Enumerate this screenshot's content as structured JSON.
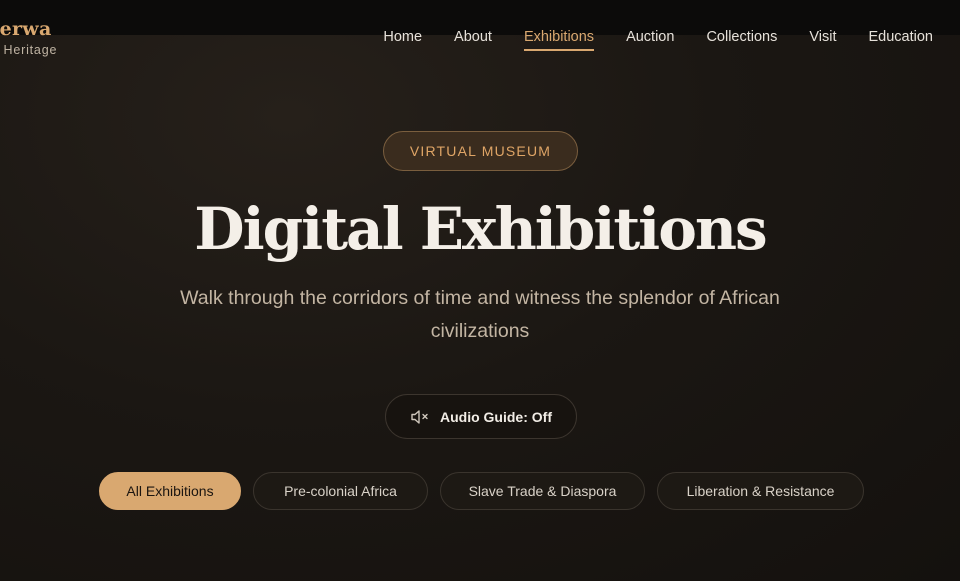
{
  "brand": {
    "name": "perwa",
    "tagline": "f Heritage"
  },
  "nav": {
    "items": [
      {
        "label": "Home"
      },
      {
        "label": "About"
      },
      {
        "label": "Exhibitions"
      },
      {
        "label": "Auction"
      },
      {
        "label": "Collections"
      },
      {
        "label": "Visit"
      },
      {
        "label": "Education"
      }
    ],
    "active": "Exhibitions"
  },
  "hero": {
    "badge": "VIRTUAL MUSEUM",
    "title": "Digital Exhibitions",
    "subtitle": "Walk through the corridors of time and witness the splendor of African civilizations"
  },
  "audio_guide": {
    "label": "Audio Guide: Off",
    "icon": "speaker-muted-icon"
  },
  "filters": {
    "items": [
      {
        "label": "All Exhibitions"
      },
      {
        "label": "Pre-colonial Africa"
      },
      {
        "label": "Slave Trade & Diaspora"
      },
      {
        "label": "Liberation & Resistance"
      }
    ],
    "active": "All Exhibitions"
  },
  "colors": {
    "accent": "#d9a870",
    "background": "#1a1612",
    "topbar": "#0c0b0a",
    "text": "#f4efe8",
    "muted": "#c3b5a3"
  }
}
